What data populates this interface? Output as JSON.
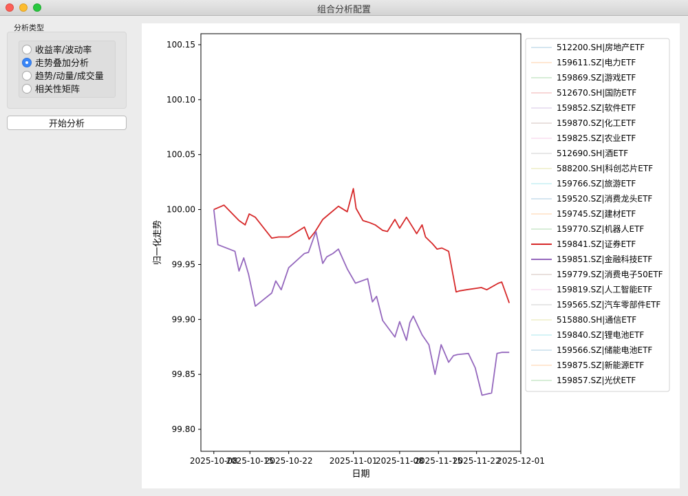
{
  "window": {
    "title": "组合分析配置"
  },
  "analysis": {
    "group_label": "分析类型",
    "options": [
      {
        "label": "收益率/波动率",
        "checked": false
      },
      {
        "label": "走势叠加分析",
        "checked": true
      },
      {
        "label": "趋势/动量/成交量",
        "checked": false
      },
      {
        "label": "相关性矩阵",
        "checked": false
      }
    ],
    "start_label": "开始分析"
  },
  "chart_data": {
    "type": "line",
    "xlabel": "日期",
    "ylabel": "归一化走势",
    "ylim": [
      99.78,
      100.16
    ],
    "yticks": [
      99.8,
      99.85,
      99.9,
      99.95,
      100.0,
      100.05,
      100.1,
      100.15
    ],
    "xticks": [
      "2025-10-08",
      "2025-10-15",
      "2025-10-22",
      "2025-11-01",
      "2025-11-08",
      "2025-11-15",
      "2025-11-22",
      "2025-12-01"
    ],
    "legend_position": "right",
    "series": [
      {
        "name": "512200.SH|房地产ETF",
        "color": "#1f77b4",
        "faded": true
      },
      {
        "name": "159611.SZ|电力ETF",
        "color": "#ff7f0e",
        "faded": true
      },
      {
        "name": "159869.SZ|游戏ETF",
        "color": "#2ca02c",
        "faded": true
      },
      {
        "name": "512670.SH|国防ETF",
        "color": "#d62728",
        "faded": true
      },
      {
        "name": "159852.SZ|软件ETF",
        "color": "#9467bd",
        "faded": true
      },
      {
        "name": "159870.SZ|化工ETF",
        "color": "#8c564b",
        "faded": true
      },
      {
        "name": "159825.SZ|农业ETF",
        "color": "#e377c2",
        "faded": true
      },
      {
        "name": "512690.SH|酒ETF",
        "color": "#7f7f7f",
        "faded": true
      },
      {
        "name": "588200.SH|科创芯片ETF",
        "color": "#bcbd22",
        "faded": true
      },
      {
        "name": "159766.SZ|旅游ETF",
        "color": "#17becf",
        "faded": true
      },
      {
        "name": "159520.SZ|消费龙头ETF",
        "color": "#1f77b4",
        "faded": true
      },
      {
        "name": "159745.SZ|建材ETF",
        "color": "#ff7f0e",
        "faded": true
      },
      {
        "name": "159770.SZ|机器人ETF",
        "color": "#2ca02c",
        "faded": true
      },
      {
        "name": "159841.SZ|证券ETF",
        "color": "#d62728",
        "faded": false,
        "x": [
          0,
          1.5,
          3.7,
          4.6,
          5.2,
          6.1,
          8.5,
          9.5,
          11.0,
          13.3,
          14.0,
          14.9,
          16.0,
          18.3,
          19.6,
          20.5,
          20.9,
          21.9,
          22.9,
          23.7,
          24.8,
          25.5,
          26.6,
          27.3,
          28.3,
          29.3,
          29.8,
          30.6,
          31.1,
          32.1,
          32.8,
          33.5,
          34.5,
          35.6,
          36.1,
          37.1,
          39.3,
          40.1,
          41.8,
          42.3,
          43.4
        ],
        "y": [
          100.0,
          100.004,
          99.99,
          99.986,
          99.996,
          99.993,
          99.974,
          99.975,
          99.975,
          99.984,
          99.973,
          99.98,
          99.991,
          100.003,
          99.998,
          100.019,
          100.001,
          99.99,
          99.988,
          99.986,
          99.981,
          99.98,
          99.991,
          99.983,
          99.993,
          99.983,
          99.978,
          99.986,
          99.975,
          99.969,
          99.964,
          99.965,
          99.962,
          99.925,
          99.926,
          99.927,
          99.929,
          99.927,
          99.933,
          99.934,
          99.915
        ]
      },
      {
        "name": "159851.SZ|金融科技ETF",
        "color": "#9467bd",
        "faded": false,
        "x": [
          0,
          0.6,
          3.1,
          3.7,
          4.4,
          5.1,
          6.1,
          8.5,
          9.1,
          9.9,
          11.0,
          13.3,
          13.9,
          15.0,
          16.0,
          16.6,
          17.5,
          18.3,
          19.6,
          20.8,
          22.6,
          23.3,
          23.9,
          24.8,
          26.6,
          27.3,
          28.3,
          28.8,
          29.3,
          30.6,
          31.6,
          32.5,
          33.4,
          34.5,
          35.2,
          35.8,
          37.4,
          38.4,
          39.4,
          40.8,
          41.6,
          42.3,
          43.4
        ],
        "y": [
          100.0,
          99.968,
          99.962,
          99.944,
          99.956,
          99.941,
          99.912,
          99.924,
          99.935,
          99.927,
          99.947,
          99.96,
          99.961,
          99.98,
          99.951,
          99.957,
          99.96,
          99.964,
          99.946,
          99.933,
          99.937,
          99.916,
          99.921,
          99.899,
          99.884,
          99.898,
          99.881,
          99.897,
          99.903,
          99.886,
          99.877,
          99.85,
          99.877,
          99.861,
          99.867,
          99.868,
          99.869,
          99.856,
          99.831,
          99.833,
          99.869,
          99.87,
          99.87
        ]
      },
      {
        "name": "159779.SZ|消费电子50ETF",
        "color": "#8c564b",
        "faded": true
      },
      {
        "name": "159819.SZ|人工智能ETF",
        "color": "#e377c2",
        "faded": true
      },
      {
        "name": "159565.SZ|汽车零部件ETF",
        "color": "#7f7f7f",
        "faded": true
      },
      {
        "name": "515880.SH|通信ETF",
        "color": "#bcbd22",
        "faded": true
      },
      {
        "name": "159840.SZ|锂电池ETF",
        "color": "#17becf",
        "faded": true
      },
      {
        "name": "159566.SZ|储能电池ETF",
        "color": "#1f77b4",
        "faded": true
      },
      {
        "name": "159875.SZ|新能源ETF",
        "color": "#ff7f0e",
        "faded": true
      },
      {
        "name": "159857.SZ|光伏ETF",
        "color": "#2ca02c",
        "faded": true
      }
    ]
  }
}
